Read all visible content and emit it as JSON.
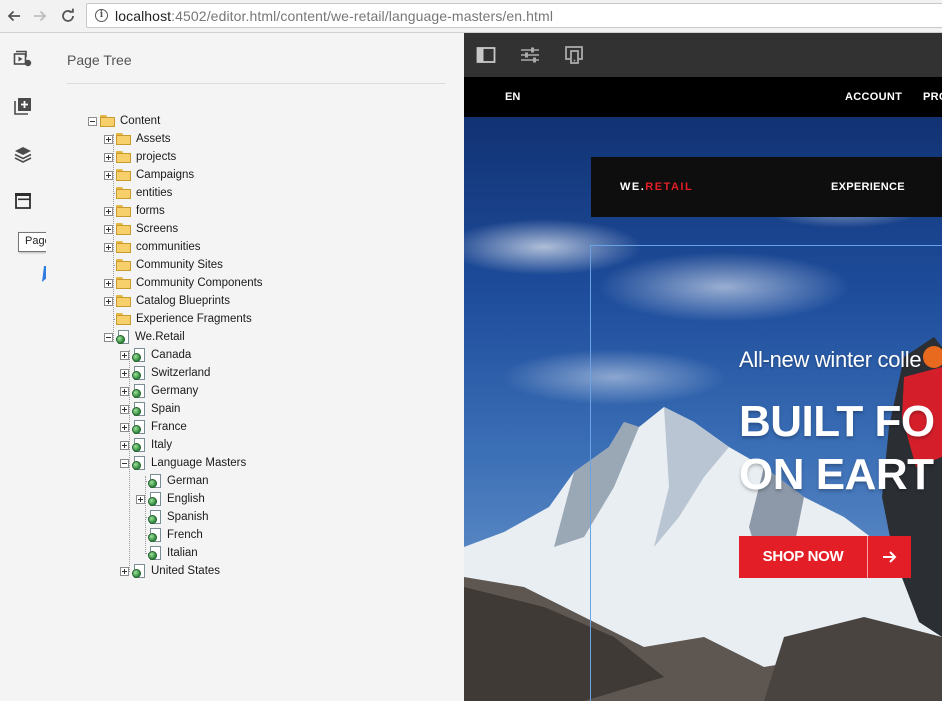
{
  "browser": {
    "url_host": "localhost",
    "url_rest": ":4502/editor.html/content/we-retail/language-masters/en.html"
  },
  "rail": {
    "tooltip": "Page Tree"
  },
  "panel": {
    "title": "Page Tree"
  },
  "tree": {
    "content": "Content",
    "assets": "Assets",
    "projects": "projects",
    "campaigns": "Campaigns",
    "entities": "entities",
    "forms": "forms",
    "screens": "Screens",
    "communities": "communities",
    "community_sites": "Community Sites",
    "community_components": "Community Components",
    "catalog_blueprints": "Catalog Blueprints",
    "experience_fragments": "Experience Fragments",
    "we_retail": "We.Retail",
    "canada": "Canada",
    "switzerland": "Switzerland",
    "germany": "Germany",
    "spain": "Spain",
    "france": "France",
    "italy": "Italy",
    "language_masters": "Language Masters",
    "german": "German",
    "english": "English",
    "spanish": "Spanish",
    "french": "French",
    "italian": "Italian",
    "united_states": "United States"
  },
  "site": {
    "lang": "EN",
    "account": "ACCOUNT",
    "products_partial": "PRO",
    "brand_white": "WE.",
    "brand_red": "RETAIL",
    "experience": "EXPERIENCE",
    "hero_sub": "All-new winter colle",
    "hero_line1": "BUILT FO",
    "hero_line2": "ON EART",
    "shop_label": "SHOP NOW"
  },
  "colors": {
    "brand_red": "#e41e26",
    "toolbar_dark": "#323232",
    "panel_bg": "#f4f4f4",
    "annotation_arrow": "#2f7de1"
  }
}
